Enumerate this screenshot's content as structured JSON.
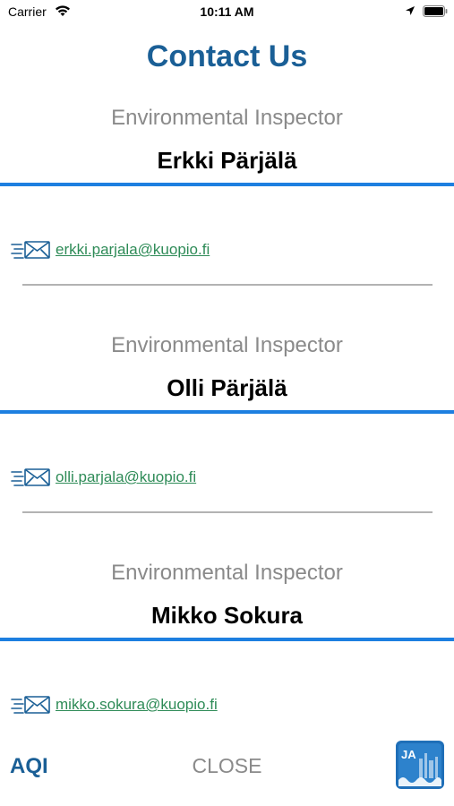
{
  "status_bar": {
    "carrier": "Carrier",
    "time": "10:11 AM"
  },
  "header": {
    "title": "Contact Us"
  },
  "contacts": [
    {
      "role": "Environmental Inspector",
      "name": "Erkki Pärjälä",
      "email": "erkki.parjala@kuopio.fi"
    },
    {
      "role": "Environmental Inspector",
      "name": "Olli Pärjälä",
      "email": "olli.parjala@kuopio.fi"
    },
    {
      "role": "Environmental Inspector",
      "name": "Mikko Sokura",
      "email": "mikko.sokura@kuopio.fi"
    }
  ],
  "bottom_bar": {
    "aqi_label": "AQI",
    "close_label": "CLOSE",
    "logo_text": "JA"
  },
  "icons": {
    "email": "mail-icon",
    "wifi": "wifi-icon",
    "location": "location-arrow-icon",
    "battery": "battery-icon",
    "logo": "app-logo-icon"
  },
  "colors": {
    "title": "#1a5f96",
    "accent_line": "#1d7fe0",
    "email_link": "#2e8b57",
    "muted_text": "#8a8a8a",
    "divider": "#b3b3b3"
  }
}
